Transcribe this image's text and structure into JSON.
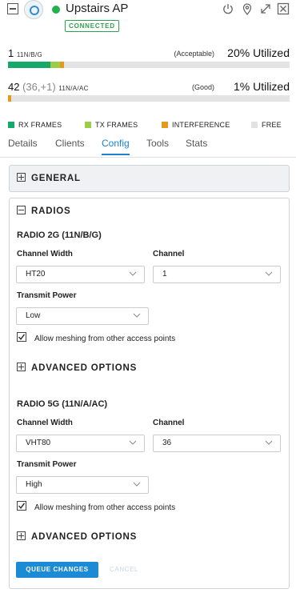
{
  "header": {
    "title": "Upstairs AP",
    "status": "CONNECTED",
    "icons": [
      "collapse-icon",
      "access-point-icon",
      "power-icon",
      "location-pin-icon",
      "expand-icon",
      "close-icon"
    ]
  },
  "radios_summary": [
    {
      "channel": "1",
      "delta": "",
      "band": "11N/B/G",
      "quality": "(Acceptable)",
      "utilization": "20% Utilized",
      "bar": {
        "rx_frames": 0.15,
        "tx_frames": 0.035,
        "interference": 0.013
      }
    },
    {
      "channel": "42",
      "delta": "(36,+1)",
      "band": "11N/A/AC",
      "quality": "(Good)",
      "utilization": "1% Utilized",
      "bar": {
        "rx_frames": 0.0,
        "tx_frames": 0.0,
        "interference": 0.01
      }
    }
  ],
  "legend": [
    {
      "label": "RX FRAMES",
      "color": "#17a86a"
    },
    {
      "label": "TX FRAMES",
      "color": "#9dcc4a"
    },
    {
      "label": "INTERFERENCE",
      "color": "#e69a1c"
    },
    {
      "label": "FREE",
      "color": "#e2e2e2"
    }
  ],
  "tabs": [
    {
      "label": "Details",
      "active": false
    },
    {
      "label": "Clients",
      "active": false
    },
    {
      "label": "Config",
      "active": true
    },
    {
      "label": "Tools",
      "active": false
    },
    {
      "label": "Stats",
      "active": false
    }
  ],
  "sections": {
    "general": "GENERAL",
    "radios": "RADIOS"
  },
  "radio_2g": {
    "title": "RADIO 2G (11N/B/G)",
    "channel_width_label": "Channel Width",
    "channel_width_value": "HT20",
    "channel_label": "Channel",
    "channel_value": "1",
    "transmit_power_label": "Transmit Power",
    "transmit_power_value": "Low",
    "meshing_label": "Allow meshing from other access points",
    "meshing_checked": true,
    "advanced_label": "ADVANCED OPTIONS"
  },
  "radio_5g": {
    "title": "RADIO 5G (11N/A/AC)",
    "channel_width_label": "Channel Width",
    "channel_width_value": "VHT80",
    "channel_label": "Channel",
    "channel_value": "36",
    "transmit_power_label": "Transmit Power",
    "transmit_power_value": "High",
    "meshing_label": "Allow meshing from other access points",
    "meshing_checked": true,
    "advanced_label": "ADVANCED OPTIONS"
  },
  "actions": {
    "queue_changes": "QUEUE CHANGES",
    "cancel": "CANCEL"
  }
}
